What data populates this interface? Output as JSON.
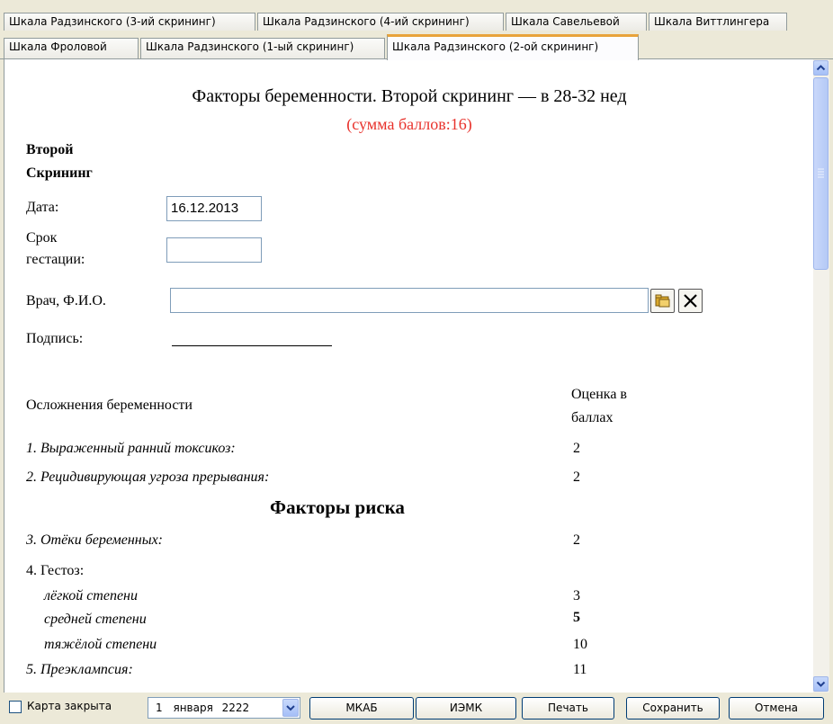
{
  "tabs": {
    "row1": [
      "Шкала Радзинского (3-ий скрининг)",
      "Шкала Радзинского (4-ий скрининг)",
      "Шкала Савельевой",
      "Шкала Виттлингера"
    ],
    "row2": [
      "Шкала Фроловой",
      "Шкала Радзинского (1-ый скрининг)",
      "Шкала Радзинского (2-ой скрининг)"
    ],
    "active": "Шкала Радзинского (2-ой скрининг)"
  },
  "form": {
    "title": "Факторы беременности. Второй скрининг — в 28-32 нед",
    "sum": "(сумма баллов:16)",
    "section_line1": "Второй",
    "section_line2": "Скрининг",
    "date_label": "Дата:",
    "date_value": "16.12.2013",
    "term_label_1": "Срок",
    "term_label_2": "гестации:",
    "term_value": "",
    "doctor_label": "Врач, Ф.И.О.",
    "doctor_value": "",
    "signature_label": "Подпись:",
    "complications_header": "Осложнения беременности",
    "score_header_1": "Оценка в",
    "score_header_2": "баллах",
    "items": [
      {
        "label": "1. Выраженный ранний токсикоз:",
        "score": "2"
      },
      {
        "label": "2. Рецидивирующая угроза прерывания:",
        "score": "2"
      }
    ],
    "risk_header": "Факторы риска",
    "risk_items": [
      {
        "label": "3. Отёки беременных:",
        "score": "2"
      }
    ],
    "gestosis_label": "4. Гестоз:",
    "gestosis_levels": [
      {
        "label": "лёгкой степени",
        "score": "3"
      },
      {
        "label": "средней степени",
        "score": "5"
      },
      {
        "label": "тяжёлой степени",
        "score": "10"
      }
    ],
    "preeclampsia": {
      "label": "5. Преэклампсия:",
      "score": "11"
    }
  },
  "bottom": {
    "card_closed_label": "Карта закрыта",
    "date_day": "1",
    "date_month": "января",
    "date_year": "2222",
    "mkab": "МКАБ",
    "iemk": "ИЭМК",
    "print": "Печать",
    "save": "Сохранить",
    "cancel": "Отмена"
  },
  "colors": {
    "accent_tab": "#e8a33a",
    "sum_red": "#e8322c"
  }
}
